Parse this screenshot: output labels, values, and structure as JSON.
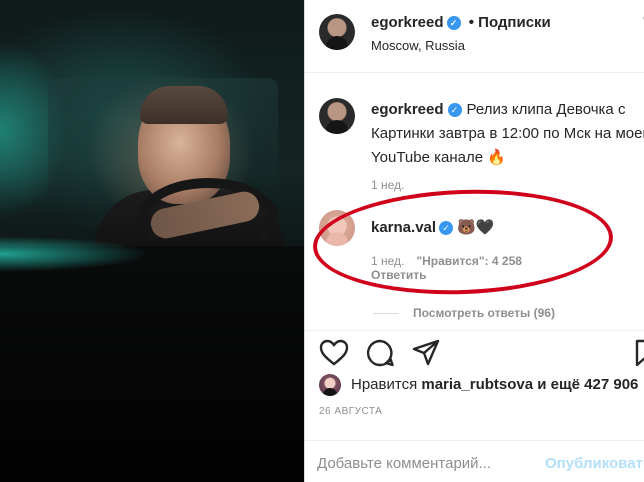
{
  "post": {
    "username": "egorkreed",
    "dot": "•",
    "follow_label": "Подписки",
    "location": "Moscow, Russia",
    "more_glyph": "•"
  },
  "caption": {
    "username": "egorkreed",
    "text": "Релиз клипа Девочка с Картинки завтра в 12:00 по Мск на моем YouTube канале 🔥",
    "time": "1 нед."
  },
  "comment": {
    "username": "karna.val",
    "emojis": "🐻🖤",
    "time": "1 нед.",
    "likes": "\"Нравится\": 4 258",
    "reply_label": "Ответить"
  },
  "view_replies": "Посмотреть ответы (96)",
  "likes_line": {
    "prefix": "Нравится",
    "user": "maria_rubtsova",
    "suffix": "и ещё 427 906"
  },
  "date": "26 АВГУСТА",
  "comment_box": {
    "placeholder": "Добавьте комментарий...",
    "post_label": "Опубликовать"
  },
  "icons": [
    "heart-icon",
    "comment-icon",
    "share-icon",
    "bookmark-icon",
    "verified-icon"
  ],
  "colors": {
    "verified": "#3897f0",
    "highlight_circle": "#d0021b",
    "post_button": "#b2dffc"
  }
}
